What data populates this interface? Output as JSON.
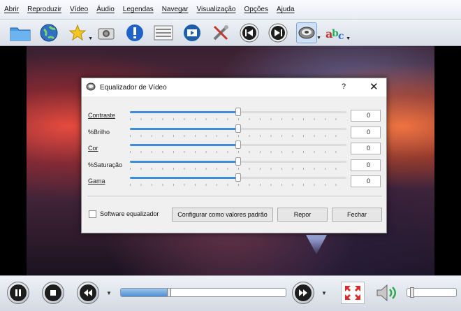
{
  "menu": [
    {
      "label": "Abrir",
      "underline": true
    },
    {
      "label": "Reproduzir",
      "underline": true
    },
    {
      "label": "Vídeo",
      "underline": true
    },
    {
      "label": "Áudio",
      "underline": true
    },
    {
      "label": "Legendas",
      "underline": true
    },
    {
      "label": "Navegar",
      "underline": true
    },
    {
      "label": "Visualização",
      "underline": false
    },
    {
      "label": "Opções",
      "underline": true
    },
    {
      "label": "Ajuda",
      "underline": false
    }
  ],
  "toolbar": {
    "icons": [
      "open-folder-icon",
      "globe-icon",
      "favorites-star-icon",
      "screenshot-camera-icon",
      "info-icon",
      "playlist-icon",
      "video-clip-icon",
      "tools-icon",
      "previous-icon",
      "next-icon",
      "equalizer-icon",
      "subtitles-abc-icon"
    ],
    "selected": "equalizer-icon"
  },
  "dialog": {
    "title": "Equalizador de Vídeo",
    "help": "?",
    "close": "✕",
    "sliders": [
      {
        "label": "Contraste",
        "value": "0",
        "level": 0.5
      },
      {
        "label": "%Brilho",
        "value": "0",
        "level": 0.5
      },
      {
        "label": "Cor",
        "value": "0",
        "level": 0.5
      },
      {
        "label": "%Saturação",
        "value": "0",
        "level": 0.5
      },
      {
        "label": "Gama",
        "value": "0",
        "level": 0.5
      }
    ],
    "software_eq_label": "Software equalizador",
    "software_eq_checked": false,
    "btn_defaults": "Configurar como valores padrão",
    "btn_reset": "Repor",
    "btn_close": "Fechar"
  },
  "controls": {
    "seek_progress": 0.28,
    "volume_level": 0.05
  },
  "colors": {
    "accent": "#3d8ed8"
  }
}
